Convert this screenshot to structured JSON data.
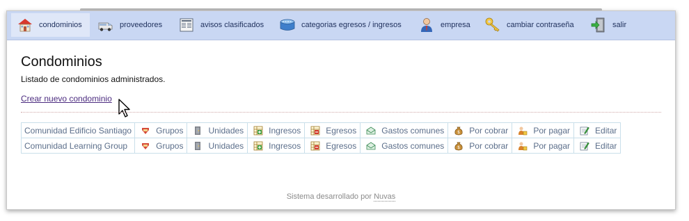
{
  "nav": [
    {
      "label": "condominios",
      "icon": "house-icon",
      "active": true
    },
    {
      "label": "proveedores",
      "icon": "van-icon"
    },
    {
      "label": "avisos clasificados",
      "icon": "newspaper-icon"
    },
    {
      "label": "categorias egresos / ingresos",
      "icon": "box-icon"
    },
    {
      "label": "empresa",
      "icon": "user-icon"
    },
    {
      "label": "cambiar contraseña",
      "icon": "key-icon"
    },
    {
      "label": "salir",
      "icon": "exit-icon"
    }
  ],
  "page": {
    "title": "Condominios",
    "description": "Listado de condominios administrados.",
    "create_link": "Crear nuevo condominio"
  },
  "actions": [
    {
      "label": "Grupos",
      "icon": "groups-icon"
    },
    {
      "label": "Unidades",
      "icon": "door-icon"
    },
    {
      "label": "Ingresos",
      "icon": "ingresos-icon"
    },
    {
      "label": "Egresos",
      "icon": "egresos-icon"
    },
    {
      "label": "Gastos comunes",
      "icon": "envelope-icon"
    },
    {
      "label": "Por cobrar",
      "icon": "money-bag-icon"
    },
    {
      "label": "Por pagar",
      "icon": "pay-icon"
    },
    {
      "label": "Editar",
      "icon": "edit-icon"
    }
  ],
  "condominios": [
    {
      "name": "Comunidad Edificio Santiago"
    },
    {
      "name": "Comunidad Learning Group"
    }
  ],
  "footer": {
    "text": "Sistema desarrollado por",
    "link": "Nuvas"
  },
  "colors": {
    "navbar": "#c9d7f3",
    "active_tab": "#dfe7f8",
    "link": "#4b2b7f",
    "table_text": "#5b6e8a",
    "table_border": "#c9dfea"
  }
}
